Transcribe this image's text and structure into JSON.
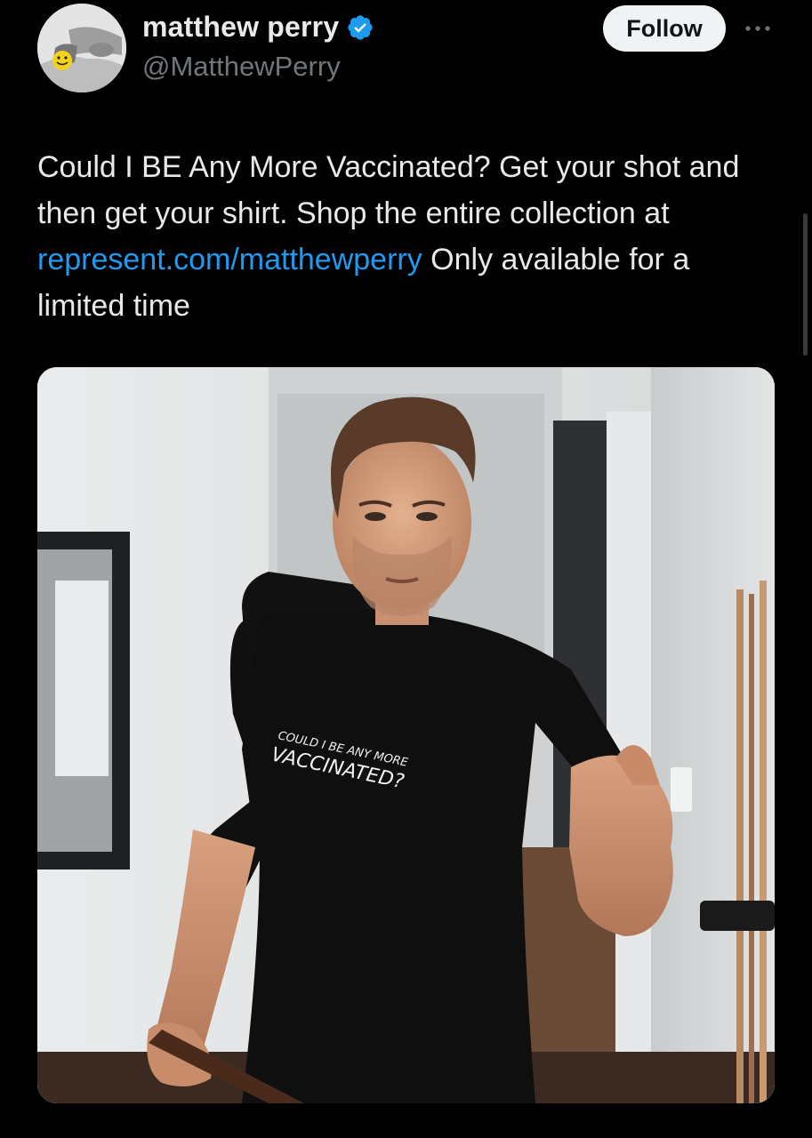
{
  "author": {
    "display_name": "matthew perry",
    "handle": "@MatthewPerry",
    "verified": true,
    "avatar_icon": "profile-photo"
  },
  "follow_label": "Follow",
  "more_icon": "more-horizontal-icon",
  "tweet": {
    "text_before_link": "Could I BE Any More Vaccinated? Get your shot and then get your shirt. Shop the entire collection at ",
    "link_text": "represent.com/matthewperry",
    "text_after_link": " Only available for a limited time"
  },
  "media": {
    "shirt_line_1": "COULD I BE ANY MORE",
    "shirt_line_2": "VACCINATED?"
  },
  "colors": {
    "background": "#000000",
    "text": "#e7e9ea",
    "secondary_text": "#71767b",
    "link": "#1d9bf0",
    "verified_badge": "#1d9bf0",
    "follow_button_bg": "#eff3f4"
  }
}
